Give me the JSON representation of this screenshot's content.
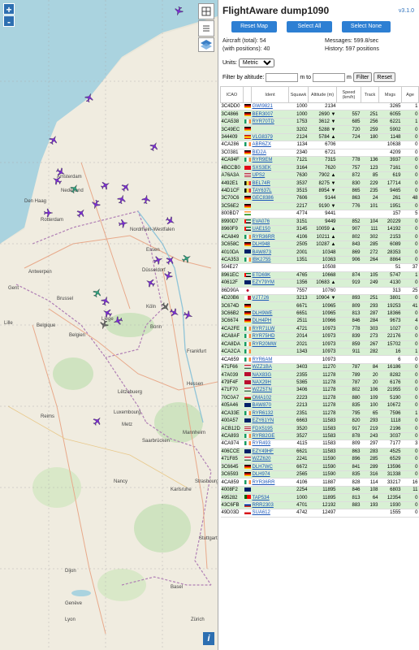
{
  "app": {
    "title": "FlightAware dump1090",
    "version": "v3.1.0"
  },
  "buttons": {
    "reset_map": "Reset Map",
    "select_all": "Select All",
    "select_none": "Select None"
  },
  "stats": {
    "aircraft_total": "Aircraft (total): 54",
    "with_positions": "(with positions): 40",
    "messages": "Messages: 599.8/sec",
    "history": "History: 597 positions"
  },
  "units": {
    "label": "Units:",
    "selected": "Metric"
  },
  "filter": {
    "label": "Filter by altitude:",
    "m_to": "m to",
    "m": "m",
    "filter_btn": "Filter",
    "reset_btn": "Reset"
  },
  "map": {
    "zoom_in": "+",
    "zoom_out": "-",
    "info": "i",
    "labels": [
      "Nederland",
      "Den Haag",
      "Amsterdam",
      "Rotterdam",
      "Antwerpen",
      "Gent",
      "Brussel",
      "Belgique",
      "Belgien",
      "Liège",
      "Lille",
      "Düsseldorf",
      "Köln",
      "Essen",
      "Bonn",
      "Lëtzebuerg",
      "Luxembourg",
      "Frankfurt",
      "Mannheim",
      "Saarbrücken",
      "Strasbourg",
      "Nancy",
      "Metz",
      "Reims",
      "Dijon",
      "Lyon",
      "Genève",
      "Zürich",
      "Basel",
      "Stuttgart",
      "Karlsruhe",
      "Nordrhein-Westfalen",
      "Hessen"
    ]
  },
  "table": {
    "headers": [
      "ICAO",
      "",
      "Ident",
      "Squawk",
      "Altitude (m)",
      "Speed (km/h)",
      "Track",
      "Msgs",
      "Age"
    ],
    "rows": [
      [
        "3C4DD0",
        "de",
        "GWI9821",
        "1000",
        "2134",
        "",
        "",
        "3265",
        "1",
        false
      ],
      [
        "3C4866",
        "de",
        "BER3007",
        "1000",
        "2690 ▼",
        "557",
        "251",
        "6055",
        "0",
        true
      ],
      [
        "4CA538",
        "ie",
        "RYR70TD",
        "1753",
        "3612 ▼",
        "685",
        "256",
        "6221",
        "1",
        true
      ],
      [
        "3C49EC",
        "de",
        "",
        "3202",
        "5288 ▼",
        "720",
        "259",
        "5902",
        "0",
        true
      ],
      [
        "344409",
        "es",
        "VLG8379",
        "2124",
        "5784 ▲",
        "724",
        "180",
        "1148",
        "0",
        true
      ],
      [
        "4CA286",
        "ie",
        "ABR6ZX",
        "1134",
        "6706",
        "",
        "",
        "10638",
        "0",
        false
      ],
      [
        "3C0381",
        "de",
        "BID2A",
        "2340",
        "6721",
        "",
        "",
        "4209",
        "0",
        false
      ],
      [
        "4CA94F",
        "ie",
        "RYR9EM",
        "7121",
        "7315",
        "778",
        "136",
        "3937",
        "0",
        true
      ],
      [
        "4BCCB0",
        "tr",
        "SXS3EK",
        "3164",
        "7620",
        "757",
        "123",
        "7161",
        "0",
        true
      ],
      [
        "A76A3A",
        "us",
        "UPS2",
        "7630",
        "7902 ▲",
        "872",
        "85",
        "619",
        "0",
        true
      ],
      [
        "4492E1",
        "be",
        "BEL74R",
        "3537",
        "8275 ▼",
        "830",
        "229",
        "17714",
        "0",
        true
      ],
      [
        "44D1CF",
        "be",
        "TAY637L",
        "3515",
        "8954 ▼",
        "865",
        "235",
        "9465",
        "0",
        true
      ],
      [
        "3C70C6",
        "de",
        "GEC8386",
        "7606",
        "9144",
        "863",
        "24",
        "261",
        "48",
        true
      ],
      [
        "3C56E2",
        "de",
        "",
        "2217",
        "9190 ▼",
        "776",
        "101",
        "1951",
        "0",
        true
      ],
      [
        "800BD7",
        "in",
        "",
        "4774",
        "9441",
        "",
        "",
        "157",
        "5",
        false
      ],
      [
        "8990D7",
        "ae",
        "EVA076",
        "3151",
        "9449",
        "852",
        "104",
        "20229",
        "0",
        true
      ],
      [
        "8960F9",
        "ae",
        "UAE150",
        "3145",
        "10059 ▲",
        "907",
        "111",
        "14192",
        "0",
        true
      ],
      [
        "4CA849",
        "ie",
        "RYR36RR",
        "4106",
        "10211 ▲",
        "802",
        "302",
        "2153",
        "0",
        true
      ],
      [
        "3C658C",
        "de",
        "DLH948",
        "2505",
        "10287 ▲",
        "843",
        "285",
        "6089",
        "0",
        true
      ],
      [
        "4010DA",
        "gb",
        "BAW873",
        "2001",
        "10348",
        "869",
        "272",
        "28353",
        "0",
        true
      ],
      [
        "4CA353",
        "ie",
        "IBK2755",
        "1351",
        "10363",
        "906",
        "264",
        "8864",
        "0",
        true
      ],
      [
        "504E27",
        "",
        "",
        "",
        "10508",
        "",
        "",
        "51",
        "37",
        false
      ],
      [
        "8961EC",
        "ae",
        "ETD69K",
        "4765",
        "10668",
        "874",
        "105",
        "5747",
        "1",
        true
      ],
      [
        "40612F",
        "gb",
        "EZY79YM",
        "1356",
        "10683 ▲",
        "919",
        "249",
        "4130",
        "0",
        true
      ],
      [
        "86D90A",
        "jp",
        "",
        "7557",
        "10760",
        "",
        "",
        "313",
        "25",
        false
      ],
      [
        "4D20B6",
        "mt",
        "VJT726",
        "3213",
        "10904 ▼",
        "893",
        "251",
        "3801",
        "0",
        true
      ],
      [
        "3C674D",
        "de",
        "",
        "6671",
        "10965",
        "809",
        "293",
        "19253",
        "41",
        true
      ],
      [
        "3C66B2",
        "de",
        "DLH9WE",
        "6651",
        "10965",
        "813",
        "287",
        "18366",
        "0",
        true
      ],
      [
        "3C6674",
        "de",
        "DLH4PH",
        "2511",
        "10966",
        "846",
        "284",
        "9673",
        "4",
        true
      ],
      [
        "4CA2FE",
        "ie",
        "RYR71LW",
        "4721",
        "10973",
        "778",
        "303",
        "1027",
        "0",
        true
      ],
      [
        "4CA8AF",
        "ie",
        "RYR75HD",
        "2014",
        "10973",
        "839",
        "273",
        "22176",
        "0",
        true
      ],
      [
        "4CA8DA",
        "ie",
        "RYR20MW",
        "2021",
        "10973",
        "859",
        "267",
        "15702",
        "0",
        true
      ],
      [
        "4CA2CA",
        "ie",
        "",
        "1343",
        "10973",
        "911",
        "282",
        "16",
        "1",
        true
      ],
      [
        "4CA659",
        "ie",
        "RYR6AM",
        "",
        "10973",
        "",
        "",
        "6",
        "0",
        false
      ],
      [
        "471F66",
        "hu",
        "WZZ1BA",
        "3403",
        "11270",
        "787",
        "84",
        "16186",
        "0",
        true
      ],
      [
        "47A039",
        "no",
        "NAX83G",
        "2355",
        "11278",
        "789",
        "20",
        "8282",
        "0",
        true
      ],
      [
        "479F4F",
        "no",
        "NAX29H",
        "5365",
        "11278",
        "787",
        "20",
        "6176",
        "0",
        true
      ],
      [
        "471F70",
        "hu",
        "WZZ5TN",
        "3406",
        "11278",
        "802",
        "106",
        "21955",
        "0",
        true
      ],
      [
        "70C0A7",
        "om",
        "OMA102",
        "2223",
        "11278",
        "880",
        "109",
        "5190",
        "0",
        true
      ],
      [
        "405A46",
        "gb",
        "BAW870",
        "2213",
        "11278",
        "835",
        "100",
        "10672",
        "0",
        true
      ],
      [
        "4CA33E",
        "ie",
        "RYR6132",
        "2351",
        "11278",
        "795",
        "65",
        "7596",
        "1",
        true
      ],
      [
        "400A57",
        "gb",
        "EZY61YN",
        "6663",
        "11583",
        "820",
        "293",
        "1118",
        "0",
        true
      ],
      [
        "ACB12D",
        "us",
        "FDX5195",
        "3520",
        "11583",
        "917",
        "219",
        "2196",
        "0",
        true
      ],
      [
        "4CA893",
        "ie",
        "RYR82GE",
        "3527",
        "11583",
        "878",
        "243",
        "3037",
        "0",
        true
      ],
      [
        "4CA974",
        "ie",
        "RYR493",
        "4115",
        "11583",
        "809",
        "297",
        "7177",
        "3",
        false
      ],
      [
        "406CCE",
        "gb",
        "EZY49HF",
        "6621",
        "11583",
        "863",
        "283",
        "4525",
        "0",
        true
      ],
      [
        "471F85",
        "hu",
        "WZZ620",
        "2241",
        "11590",
        "896",
        "285",
        "6529",
        "0",
        true
      ],
      [
        "3C6645",
        "de",
        "DLH7WC",
        "6672",
        "11590",
        "841",
        "289",
        "13596",
        "0",
        true
      ],
      [
        "3C6593",
        "de",
        "DLH974",
        "2565",
        "11590",
        "835",
        "316",
        "31338",
        "0",
        true
      ],
      [
        "4CA859",
        "ie",
        "RYR36RR",
        "4106",
        "11887",
        "828",
        "114",
        "33217",
        "16",
        false
      ],
      [
        "4008F2",
        "gb",
        "",
        "2254",
        "11895",
        "846",
        "108",
        "6803",
        "11",
        true
      ],
      [
        "495282",
        "pt",
        "TAP534",
        "1000",
        "11895",
        "813",
        "64",
        "12354",
        "0",
        true
      ],
      [
        "43C6FB",
        "ru",
        "RRR2303",
        "4701",
        "12192",
        "883",
        "193",
        "1930",
        "0",
        true
      ],
      [
        "49D03D",
        "cz",
        "SUA612",
        "4742",
        "12497",
        "",
        "",
        "1555",
        "0",
        false
      ]
    ]
  },
  "colors": {
    "button": "#2d7fd3",
    "row_pos": "#d8f0d4",
    "plane_purple": "#7b2ad6",
    "plane_teal": "#2aa37e",
    "plane_gray": "#666666"
  }
}
